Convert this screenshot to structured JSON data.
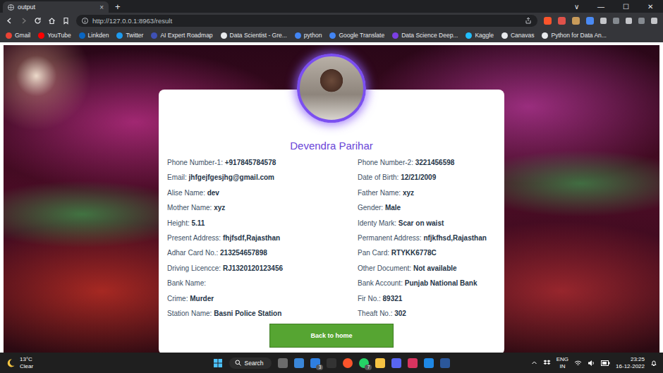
{
  "browser": {
    "tab": {
      "label": "output",
      "selected": true,
      "close": "×"
    },
    "new_tab": "+",
    "window_controls": [
      "∨",
      "—",
      "☐",
      "✕"
    ],
    "url": "http://127.0.0.1:8963/result"
  },
  "bookmarks": [
    "Gmail",
    "YouTube",
    "Linkden",
    "Twitter",
    "AI Expert Roadmap",
    "Data Scientist - Gre...",
    "python",
    "Google Translate",
    "Data Science Deep...",
    "Kaggle",
    "Canavas",
    "Python for Data An..."
  ],
  "profile": {
    "name": "Devendra Parihar",
    "fields": [
      {
        "label": "Phone Number-1:",
        "value": "+917845784578"
      },
      {
        "label": "Phone Number-2:",
        "value": "3221456598"
      },
      {
        "label": "Email:",
        "value": "jhfgejfgesjhg@gmail.com"
      },
      {
        "label": "Date of Birth:",
        "value": "12/21/2009"
      },
      {
        "label": "Alise Name:",
        "value": "dev"
      },
      {
        "label": "Father Name:",
        "value": "xyz"
      },
      {
        "label": "Mother Name:",
        "value": "xyz"
      },
      {
        "label": "Gender:",
        "value": "Male"
      },
      {
        "label": "Height:",
        "value": "5.11"
      },
      {
        "label": "Identy Mark:",
        "value": "Scar on waist"
      },
      {
        "label": "Present Address:",
        "value": "fhjfsdf,Rajasthan"
      },
      {
        "label": "Permanent Address:",
        "value": "nfjkfhsd,Rajasthan"
      },
      {
        "label": "Adhar Card No.:",
        "value": "213254657898"
      },
      {
        "label": "Pan Card:",
        "value": "RTYKK6778C"
      },
      {
        "label": "Driving Licencce:",
        "value": "RJ1320120123456"
      },
      {
        "label": "Other Document:",
        "value": "Not available"
      },
      {
        "label": "Bank Name:"
      },
      {
        "label": "Bank Account:",
        "value": "Punjab National Bank"
      },
      {
        "label": "Crime:",
        "value": "Murder"
      },
      {
        "label": "Fir No.:",
        "value": "89321"
      },
      {
        "label": "Station Name:",
        "value": "Basni Police Station"
      },
      {
        "label": "Theaft No.:",
        "value": "302"
      }
    ],
    "button": "Back to home"
  },
  "taskbar": {
    "weather": {
      "temp": "13°C",
      "condition": "Clear"
    },
    "search": "Search",
    "app_badges": [
      "3",
      "7"
    ],
    "language": "ENG",
    "region": "IN",
    "time": "23:25",
    "date": "16-12-2022"
  }
}
